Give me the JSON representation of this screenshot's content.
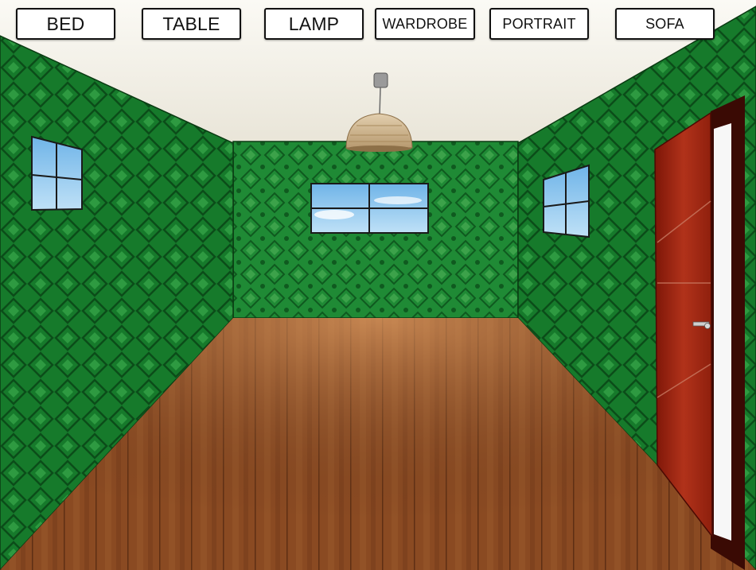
{
  "toolbar": {
    "buttons": [
      {
        "id": "bed",
        "label": "BED"
      },
      {
        "id": "table",
        "label": "TABLE"
      },
      {
        "id": "lamp",
        "label": "LAMP"
      },
      {
        "id": "wardrobe",
        "label": "WARDROBE"
      },
      {
        "id": "portrait",
        "label": "PORTRAIT"
      },
      {
        "id": "sofa",
        "label": "SOFA"
      }
    ]
  },
  "room": {
    "wall_color": "#1f8a35",
    "ceiling_color": "#f3f0e6",
    "floor_color": "#8a4a22",
    "door_color": "#a3200f",
    "sky_color": "#8cc6ee"
  }
}
